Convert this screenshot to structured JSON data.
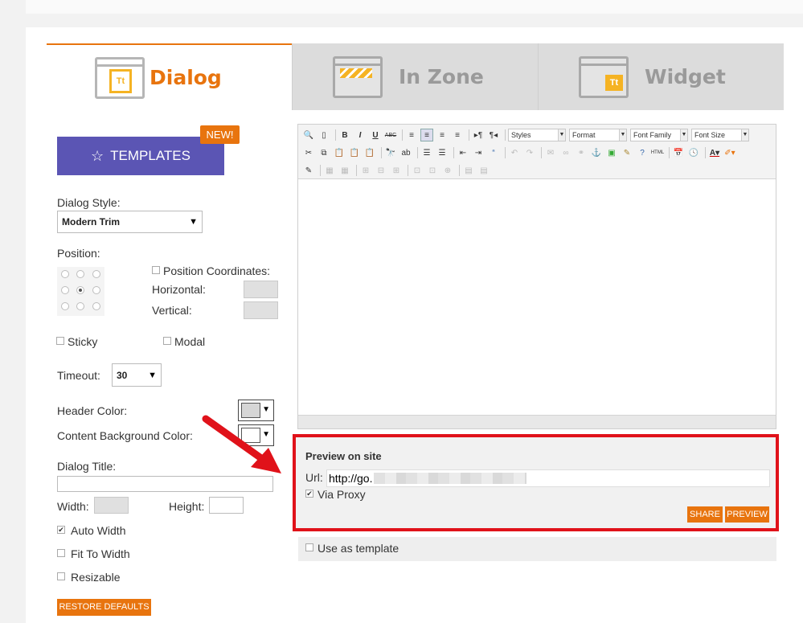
{
  "tabs": [
    {
      "label": "Dialog",
      "icon": "dialog-window-icon",
      "active": true
    },
    {
      "label": "In Zone",
      "icon": "zone-window-icon",
      "active": false
    },
    {
      "label": "Widget",
      "icon": "widget-window-icon",
      "active": false
    }
  ],
  "templates": {
    "label": "TEMPLATES",
    "badge": "NEW!"
  },
  "form": {
    "dialog_style_label": "Dialog Style:",
    "dialog_style_value": "Modern Trim",
    "position_label": "Position:",
    "position_coords_label": "Position Coordinates:",
    "horizontal_label": "Horizontal:",
    "vertical_label": "Vertical:",
    "sticky_label": "Sticky",
    "modal_label": "Modal",
    "timeout_label": "Timeout:",
    "timeout_value": "30",
    "header_color_label": "Header Color:",
    "content_bg_label": "Content Background Color:",
    "dialog_title_label": "Dialog Title:",
    "width_label": "Width:",
    "height_label": "Height:",
    "auto_width_label": "Auto Width",
    "fit_to_width_label": "Fit To Width",
    "resizable_label": "Resizable",
    "restore_label": "RESTORE DEFAULTS"
  },
  "toolbar": {
    "styles": "Styles",
    "format": "Format",
    "font_family": "Font Family",
    "font_size": "Font Size"
  },
  "preview": {
    "title": "Preview on site",
    "url_label": "Url:",
    "url_value": "http://go.",
    "via_proxy_label": "Via Proxy",
    "share_label": "SHARE",
    "preview_label": "PREVIEW"
  },
  "use_template_label": "Use as template",
  "colors": {
    "accent": "#e8740e",
    "templates_btn": "#5b55b4",
    "highlight": "#e0121a",
    "header_swatch": "#d6d6d6"
  }
}
